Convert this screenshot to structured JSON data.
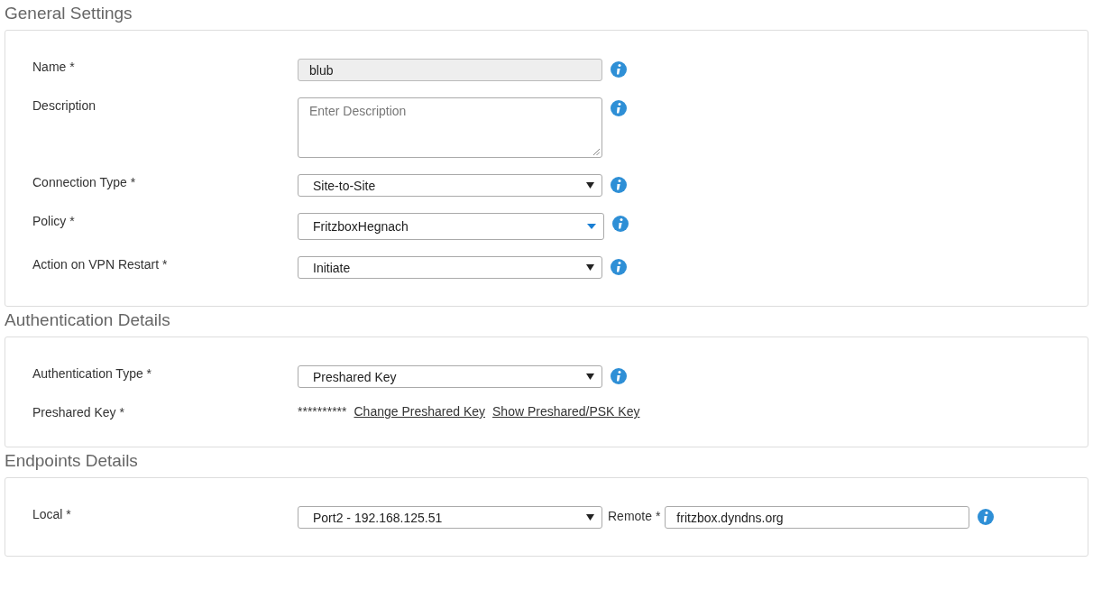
{
  "sections": [
    {
      "title": "General Settings",
      "rows": [
        {
          "kind": "text",
          "label": "Name *",
          "value": "blub",
          "disabled": true,
          "info": true
        },
        {
          "kind": "textarea",
          "label": "Description",
          "placeholder": "Enter Description",
          "info": true
        },
        {
          "kind": "select",
          "label": "Connection Type *",
          "value": "Site-to-Site",
          "info": true
        },
        {
          "kind": "combo",
          "label": "Policy *",
          "value": "FritzboxHegnach",
          "info": true
        },
        {
          "kind": "select",
          "label": "Action on VPN Restart *",
          "value": "Initiate",
          "info": true
        }
      ]
    },
    {
      "title": "Authentication Details",
      "rows": [
        {
          "kind": "select",
          "label": "Authentication Type *",
          "value": "Preshared Key",
          "info": true
        },
        {
          "kind": "secret",
          "label": "Preshared Key *",
          "value": "**********",
          "links": [
            "Change Preshared Key",
            "Show Preshared/PSK Key"
          ]
        }
      ]
    },
    {
      "title": "Endpoints Details",
      "rows": [
        {
          "kind": "endpoint",
          "label": "Local *",
          "value": "Port2 - 192.168.125.51",
          "remote_label": "Remote *",
          "remote_value": "fritzbox.dyndns.org",
          "info": true
        }
      ]
    }
  ]
}
